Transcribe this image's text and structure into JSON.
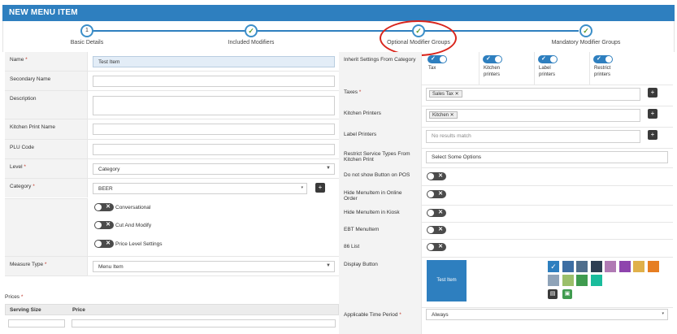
{
  "title": "NEW MENU ITEM",
  "steps": [
    {
      "marker": "1",
      "label": "Basic Details"
    },
    {
      "marker": "✓",
      "label": "Included Modifiers"
    },
    {
      "marker": "✓",
      "label": "Optional Modifier Groups"
    },
    {
      "marker": "✓",
      "label": "Mandatory Modifier Groups"
    }
  ],
  "left": {
    "name": {
      "label": "Name",
      "required": "*",
      "value": "Test Item"
    },
    "secondary_name": {
      "label": "Secondary Name",
      "value": ""
    },
    "description": {
      "label": "Description",
      "value": ""
    },
    "kitchen_print_name": {
      "label": "Kitchen Print Name",
      "value": ""
    },
    "plu_code": {
      "label": "PLU Code",
      "value": ""
    },
    "level": {
      "label": "Level",
      "required": "*",
      "value": "Category"
    },
    "category": {
      "label": "Category",
      "required": "*",
      "value": "BEER",
      "add_icon": "plus-icon"
    },
    "toggles": [
      {
        "label": "Conversational",
        "on": false
      },
      {
        "label": "Cut And Modify",
        "on": false
      },
      {
        "label": "Price Level Settings",
        "on": false
      }
    ],
    "measure_type": {
      "label": "Measure Type",
      "required": "*",
      "value": "Menu Item"
    },
    "prices": {
      "label": "Prices",
      "required": "*",
      "columns": [
        "Serving Size",
        "Price"
      ]
    }
  },
  "right": {
    "inherit": {
      "label": "Inherit Settings From Category",
      "items": [
        {
          "label": "Tax",
          "on": true
        },
        {
          "label": "Kitchen printers",
          "on": true
        },
        {
          "label": "Label printers",
          "on": true
        },
        {
          "label": "Restrict printers",
          "on": true
        }
      ]
    },
    "taxes": {
      "label": "Taxes",
      "required": "*",
      "tags": [
        "Sales Tax"
      ]
    },
    "kitchen_printers": {
      "label": "Kitchen Printers",
      "tags": [
        "Kitchen"
      ]
    },
    "label_printers": {
      "label": "Label Printers",
      "placeholder": "No results match"
    },
    "restrict_service": {
      "label": "Restrict Service Types From Kitchen Print",
      "placeholder": "Select Some Options"
    },
    "switches": [
      {
        "label": "Do not show Button on POS",
        "on": false
      },
      {
        "label": "Hide MenuItem in Online Order",
        "on": false
      },
      {
        "label": "Hide MenuItem in Kiosk",
        "on": false
      },
      {
        "label": "EBT MenuItem",
        "on": false
      },
      {
        "label": "86 List",
        "on": false
      }
    ],
    "display_button": {
      "label": "Display Button",
      "preview_text": "Test Item",
      "colors": [
        "#2e7fbf",
        "#3d6ea3",
        "#4f6e8c",
        "#2e3e52",
        "#b07ab4",
        "#8e44ad",
        "#e0b04a",
        "#e67e22",
        "#8fa3b8",
        "#9bbf6a",
        "#3f9b4f",
        "#1abc9c"
      ],
      "selected_color": "#2e7fbf"
    },
    "time_period": {
      "label": "Applicable Time Period",
      "required": "*",
      "value": "Always"
    }
  }
}
